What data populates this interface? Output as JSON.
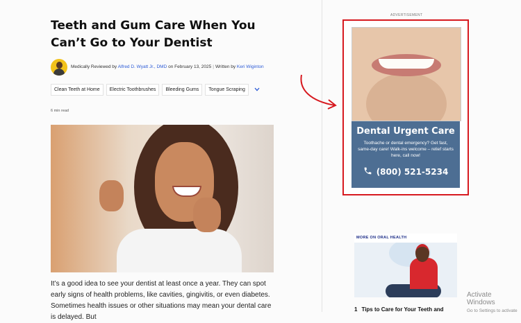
{
  "article": {
    "title": "Teeth and Gum Care When You Can’t Go to Your Dentist",
    "byline": {
      "prefix": "Medically Reviewed by ",
      "reviewer": "Alfred D. Wyatt Jr., DMD",
      "date_text": " on February 13, 2025",
      "separator": "|",
      "written_prefix": "Written by ",
      "writer": "Keri Wiginton"
    },
    "tags": [
      "Clean Teeth at Home",
      "Electric Toothbrushes",
      "Bleeding Gums",
      "Tongue Scraping"
    ],
    "read_time": "6 min read",
    "body": "It’s a good idea to see your dentist at least once a year. They can spot early signs of health problems, like cavities, gingivitis, or even diabetes. Sometimes health issues or other situations may mean your dental care is delayed. But"
  },
  "ad": {
    "label": "ADVERTISEMENT",
    "headline": "Dental Urgent Care",
    "subtext": "Toothache or dental emergency? Get fast, same-day care! Walk-ins welcome – relief starts here, call now!",
    "phone": "(800) 521-5234",
    "highlight_color": "#d7191f",
    "panel_color": "#4d6e93"
  },
  "sidebar": {
    "more_label": "MORE ON ORAL HEALTH",
    "item_number": "1",
    "item_title": "Tips to Care for Your Teeth and"
  },
  "watermark": {
    "line1": "Activate Windows",
    "line2": "Go to Settings to activate"
  },
  "icons": {
    "tags_expand": "chevron-down-icon",
    "phone": "phone-icon",
    "annotation": "red-curved-arrow-icon"
  }
}
